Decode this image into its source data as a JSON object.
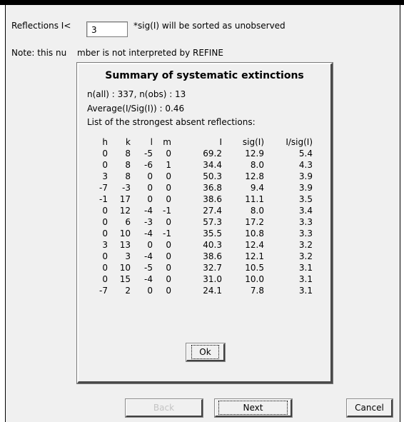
{
  "main": {
    "reflections_label_prefix": "Reflections I<",
    "threshold_value": "3",
    "reflections_label_suffix": "*sig(I) will be sorted as unobserved",
    "note_prefix": "Note: this nu",
    "note_suffix": "mber is not interpreted by REFINE"
  },
  "dialog": {
    "title": "Summary of systematic extinctions",
    "counts_line": "n(all) :   337, n(obs) :     13",
    "average_line": "Average(I/Sig(I)) :  0.46",
    "list_line": "List of the strongest absent reflections:",
    "columns": [
      "h",
      "k",
      "l",
      "m",
      "I",
      "sig(I)",
      "I/sig(I)"
    ],
    "rows": [
      [
        "0",
        "8",
        "-5",
        "0",
        "69.2",
        "12.9",
        "5.4"
      ],
      [
        "0",
        "8",
        "-6",
        "1",
        "34.4",
        "8.0",
        "4.3"
      ],
      [
        "3",
        "8",
        "0",
        "0",
        "50.3",
        "12.8",
        "3.9"
      ],
      [
        "-7",
        "-3",
        "0",
        "0",
        "36.8",
        "9.4",
        "3.9"
      ],
      [
        "-1",
        "17",
        "0",
        "0",
        "38.6",
        "11.1",
        "3.5"
      ],
      [
        "0",
        "12",
        "-4",
        "-1",
        "27.4",
        "8.0",
        "3.4"
      ],
      [
        "0",
        "6",
        "-3",
        "0",
        "57.3",
        "17.2",
        "3.3"
      ],
      [
        "0",
        "10",
        "-4",
        "-1",
        "35.5",
        "10.8",
        "3.3"
      ],
      [
        "3",
        "13",
        "0",
        "0",
        "40.3",
        "12.4",
        "3.2"
      ],
      [
        "0",
        "3",
        "-4",
        "0",
        "38.6",
        "12.1",
        "3.2"
      ],
      [
        "0",
        "10",
        "-5",
        "0",
        "32.7",
        "10.5",
        "3.1"
      ],
      [
        "0",
        "15",
        "-4",
        "0",
        "31.0",
        "10.0",
        "3.1"
      ],
      [
        "-7",
        "2",
        "0",
        "0",
        "24.1",
        "7.8",
        "3.1"
      ]
    ],
    "ok_label": "Ok"
  },
  "buttons": {
    "back_label": "Back",
    "next_label": "Next",
    "cancel_label": "Cancel"
  }
}
